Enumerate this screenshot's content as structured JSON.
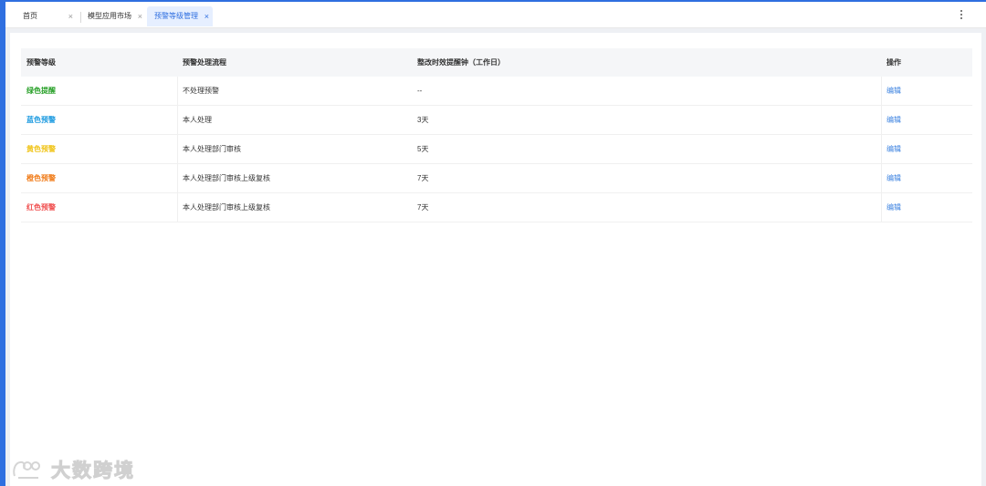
{
  "tabs": [
    {
      "label": "首页",
      "close": "×",
      "active": false
    },
    {
      "label": "模型应用市场",
      "close": "×",
      "active": false
    },
    {
      "label": "预警等级管理",
      "close": "×",
      "active": true
    }
  ],
  "table": {
    "headers": [
      "预警等级",
      "预警处理流程",
      "整改时效提醒钟（工作日）",
      "操作"
    ],
    "rows": [
      {
        "level": "绿色提醒",
        "color": "#2aa12a",
        "process": "不处理预警",
        "timeliness": "--",
        "action": "编辑"
      },
      {
        "level": "蓝色预警",
        "color": "#1e9be0",
        "process": "本人处理",
        "timeliness": "3天",
        "action": "编辑"
      },
      {
        "level": "黄色预警",
        "color": "#f0c419",
        "process": "本人处理部门审核",
        "timeliness": "5天",
        "action": "编辑"
      },
      {
        "level": "橙色预警",
        "color": "#f07c1a",
        "process": "本人处理部门审核上级复核",
        "timeliness": "7天",
        "action": "编辑"
      },
      {
        "level": "红色预警",
        "color": "#f05050",
        "process": "本人处理部门审核上级复核",
        "timeliness": "7天",
        "action": "编辑"
      }
    ]
  },
  "watermark": {
    "text": "大数跨境",
    "icon": "brand-logo-icon"
  },
  "icons": {
    "more": "more-vertical-icon",
    "close": "close-icon"
  },
  "colors": {
    "accent": "#2f6fe0",
    "link": "#3b82e0"
  }
}
